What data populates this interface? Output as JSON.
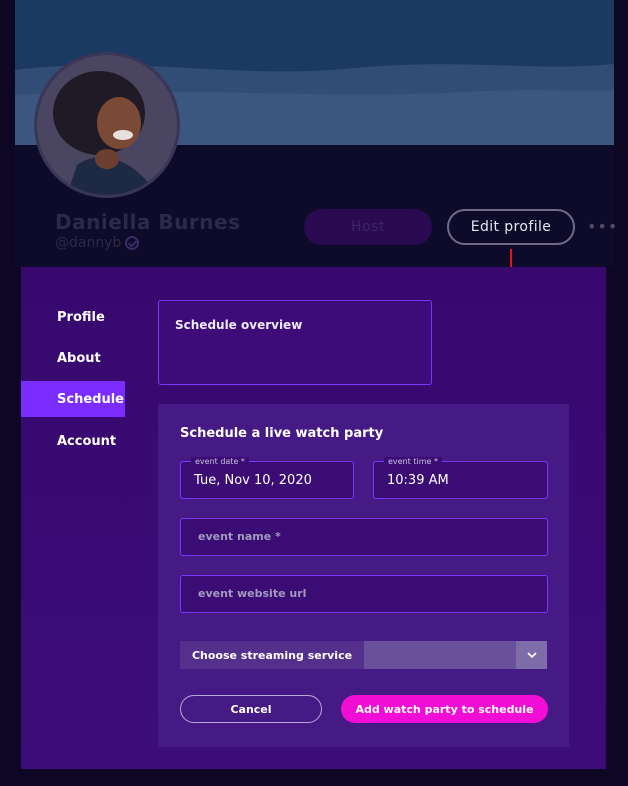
{
  "user": {
    "name": "Daniella Burnes",
    "handle": "@dannyb"
  },
  "header": {
    "host_label": "Host",
    "edit_profile_label": "Edit profile",
    "more_label": "•••"
  },
  "sidebar": {
    "items": [
      {
        "label": "Profile",
        "active": false
      },
      {
        "label": "About",
        "active": false
      },
      {
        "label": "Schedule",
        "active": true
      },
      {
        "label": "Account",
        "active": false
      }
    ]
  },
  "overview": {
    "title": "Schedule overview"
  },
  "form": {
    "title": "Schedule a live watch party",
    "event_date": {
      "label": "event date *",
      "value": "Tue, Nov 10, 2020"
    },
    "event_time": {
      "label": "event time *",
      "value": "10:39 AM"
    },
    "event_name": {
      "placeholder": "event name *"
    },
    "event_url": {
      "placeholder": "event website url"
    },
    "streaming_service": {
      "label": "Choose streaming service",
      "value": ""
    },
    "cancel_label": "Cancel",
    "submit_label": "Add watch party to schedule"
  },
  "colors": {
    "accent_purple": "#7b2cff",
    "submit_magenta": "#f10dd6",
    "annotation_arrow": "#e0141e"
  },
  "icons": {
    "verified": "verified-badge-icon",
    "chevron": "chevron-down-icon",
    "more": "more-horizontal-icon",
    "annotation": "arrow-down-icon"
  }
}
